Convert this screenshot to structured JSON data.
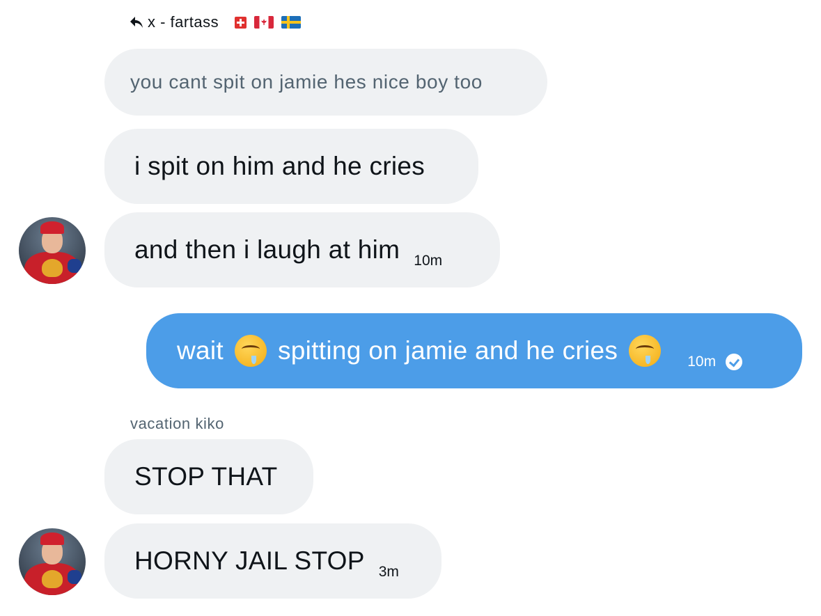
{
  "reply_header": {
    "text": "x - fartass",
    "icon": "reply-arrow-icon",
    "flags": [
      "flag-switzerland",
      "flag-canada",
      "flag-sweden"
    ]
  },
  "quoted_message": {
    "text": "you cant spit on jamie hes nice boy too"
  },
  "received_group_1": {
    "messages": [
      {
        "text": "i spit on him and he cries",
        "time": ""
      },
      {
        "text": "and then i laugh at him",
        "time": "10m"
      }
    ],
    "avatar": "hockey-player-avatar"
  },
  "sent_message": {
    "text_before": "wait",
    "text_middle": "spitting on jamie and he cries",
    "emoji": "drooling-face-emoji",
    "time": "10m",
    "status_icon": "read-check-icon"
  },
  "received_group_2": {
    "sender": "vacation kiko",
    "messages": [
      {
        "text": "STOP THAT",
        "time": ""
      },
      {
        "text": "HORNY JAIL STOP",
        "time": "3m"
      }
    ],
    "avatar": "hockey-player-avatar"
  },
  "colors": {
    "received_bubble": "#eff1f3",
    "sent_bubble": "#4c9de8",
    "secondary_text": "#536471",
    "primary_text": "#0f1419"
  }
}
